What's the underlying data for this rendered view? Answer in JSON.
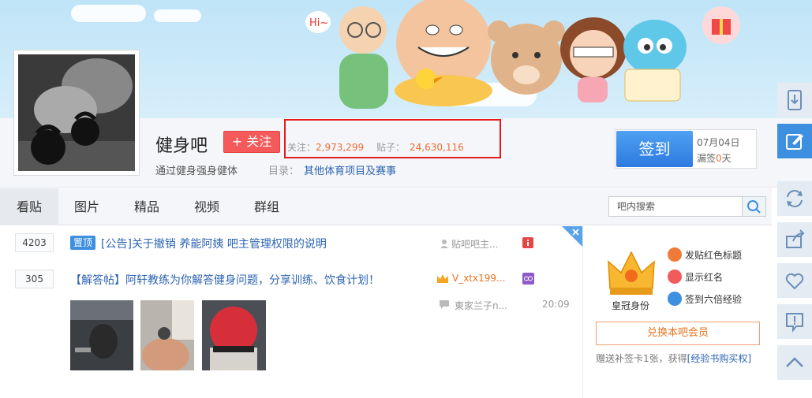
{
  "forum": {
    "name": "健身吧",
    "follow_label": "+ 关注",
    "slogan": "通过健身强身健体",
    "directory_label": "目录：",
    "directory_value": "其他体育项目及赛事",
    "stats": {
      "follow_label": "关注：",
      "follow_count": "2,973,299",
      "posts_label": "贴子：",
      "posts_count": "24,630,116"
    }
  },
  "signin": {
    "button_label": "签到",
    "date": "07月04日",
    "missed_prefix": "漏签",
    "missed_count": "0",
    "missed_suffix": "天"
  },
  "tabs": [
    "看贴",
    "图片",
    "精品",
    "视频",
    "群组"
  ],
  "search": {
    "placeholder": "吧内搜索"
  },
  "posts": [
    {
      "reply_count": "4203",
      "badge": "置顶",
      "title": "[公告]关于撤销 养能阿姨 吧主管理权限的说明",
      "author": "贴吧吧主..."
    },
    {
      "reply_count": "305",
      "title": "【解答帖】阿轩教练为你解答健身问题，分享训练、饮食计划！",
      "author": "V_xtx199...",
      "last_reply_author": "東家兰子n...",
      "last_reply_time": "20:09"
    }
  ],
  "sidebar": {
    "crown_label": "皇冠身份",
    "perks": [
      "发贴红色标题",
      "显示红名",
      "签到六倍经验"
    ],
    "member_button": "兑换本吧会员",
    "bonus_text": "赠送补签卡1张，获得",
    "bonus_link": "[经验书购买权]"
  },
  "banner": {
    "bubble_text": "Hi~"
  },
  "colors": {
    "accent_blue": "#3d8fe0",
    "follow_red": "#f55a5a",
    "highlight_border": "#e31b1b",
    "stat_number": "#f06c35",
    "link_blue": "#2d64b3"
  },
  "icons": {
    "float_toolbar": [
      "download-icon",
      "edit-icon",
      "refresh-icon",
      "share-icon",
      "favorite-icon",
      "report-icon",
      "back-to-top-icon"
    ]
  }
}
